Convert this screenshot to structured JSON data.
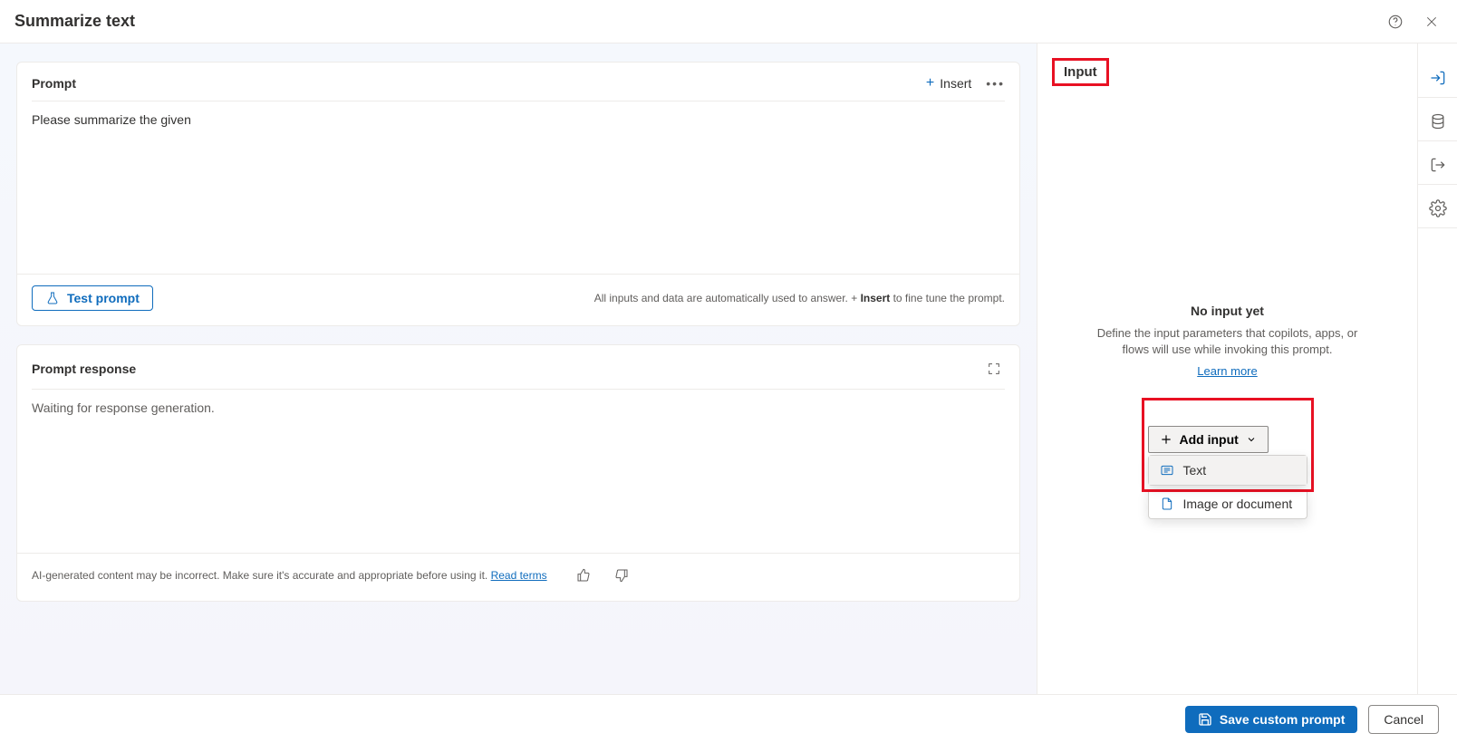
{
  "header": {
    "title": "Summarize text"
  },
  "prompt_card": {
    "title": "Prompt",
    "insert_label": "Insert",
    "body_text": "Please summarize the given",
    "test_label": "Test prompt",
    "hint_prefix": "All inputs and data are automatically used to answer. ",
    "hint_plus": "+ ",
    "hint_insert": "Insert",
    "hint_suffix": " to fine tune the prompt."
  },
  "response_card": {
    "title": "Prompt response",
    "body_text": "Waiting for response generation.",
    "disclaimer": "AI-generated content may be incorrect. Make sure it's accurate and appropriate before using it. ",
    "read_terms": "Read terms"
  },
  "input_panel": {
    "tab_label": "Input",
    "empty_title": "No input yet",
    "empty_desc": "Define the input parameters that copilots, apps, or flows will use while invoking this prompt.",
    "learn_more": "Learn more",
    "add_input_label": "Add input",
    "options": {
      "text": "Text",
      "image": "Image or document"
    }
  },
  "footer": {
    "save_label": "Save custom prompt",
    "cancel_label": "Cancel"
  }
}
